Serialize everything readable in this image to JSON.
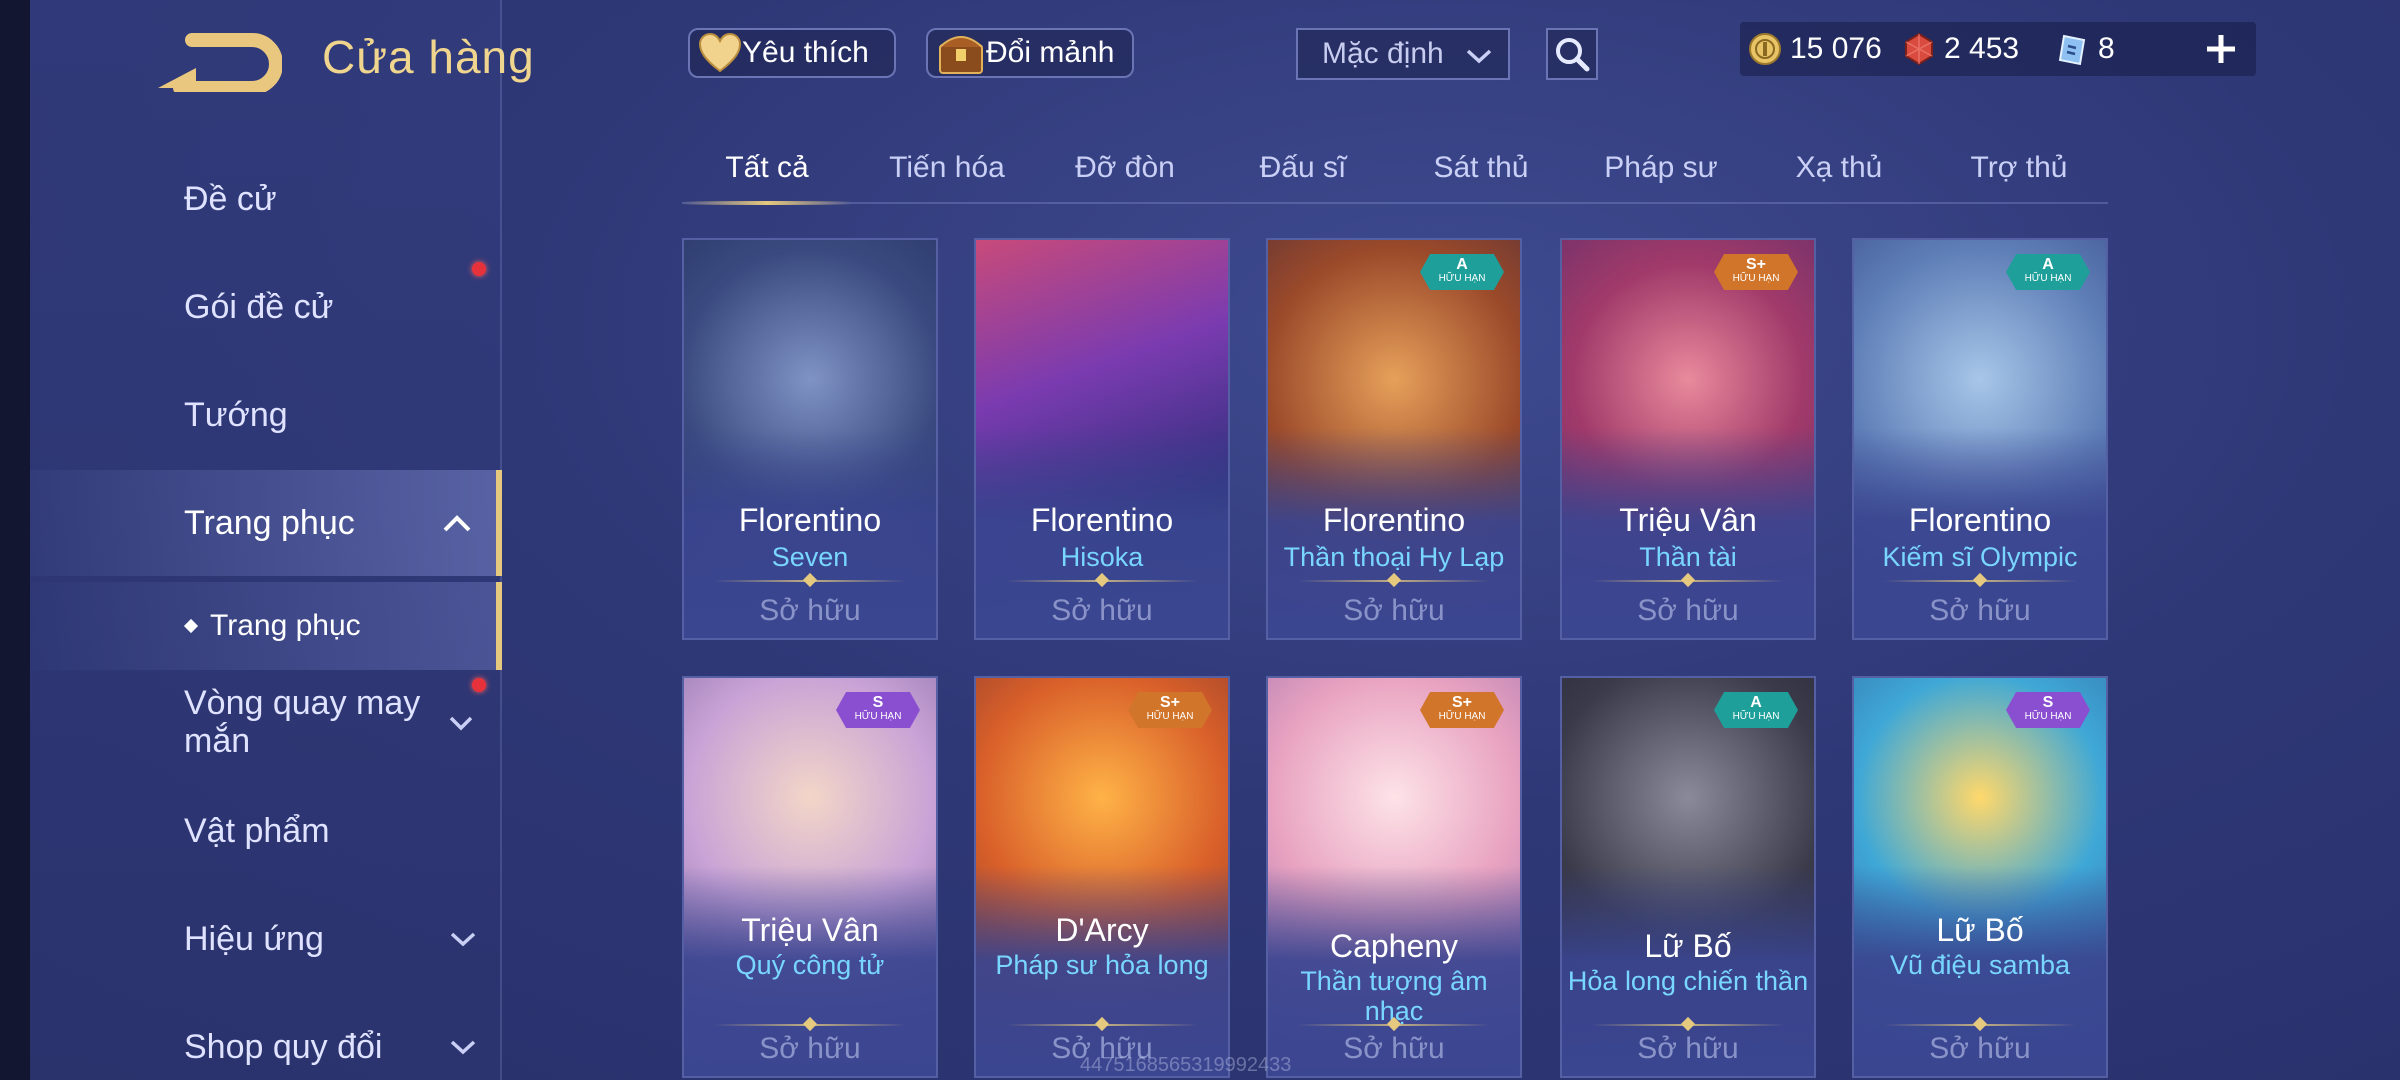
{
  "header": {
    "title": "Cửa hàng",
    "favorites_label": "Yêu thích",
    "exchange_label": "Đổi mảnh",
    "sort_selected": "Mặc định"
  },
  "currency": {
    "gold": "15 076",
    "vouchers": "2 453",
    "tickets": "8"
  },
  "sidebar": {
    "items": [
      {
        "label": "Đề cử"
      },
      {
        "label": "Gói đề cử",
        "red_dot": true
      },
      {
        "label": "Tướng"
      },
      {
        "label": "Trang phục",
        "expanded": true
      },
      {
        "label": "Trang phục",
        "sub": true
      },
      {
        "label": "Vòng quay may mắn",
        "red_dot": true
      },
      {
        "label": "Vật phẩm"
      },
      {
        "label": "Hiệu ứng"
      },
      {
        "label": "Shop quy đổi"
      }
    ]
  },
  "tabs": [
    "Tất cả",
    "Tiến hóa",
    "Đỡ đòn",
    "Đấu sĩ",
    "Sát thủ",
    "Pháp sư",
    "Xạ thủ",
    "Trợ thủ"
  ],
  "active_tab": "Tất cả",
  "cards": [
    {
      "hero": "Florentino",
      "skin": "Seven",
      "status": "Sở hữu",
      "tier": "",
      "tier_sub": ""
    },
    {
      "hero": "Florentino",
      "skin": "Hisoka",
      "status": "Sở hữu",
      "tier": "",
      "tier_sub": ""
    },
    {
      "hero": "Florentino",
      "skin": "Thần thoại Hy Lạp",
      "status": "Sở hữu",
      "tier": "A",
      "tier_sub": "HỮU HẠN"
    },
    {
      "hero": "Triệu Vân",
      "skin": "Thần tài",
      "status": "Sở hữu",
      "tier": "S+",
      "tier_sub": "HỮU HẠN"
    },
    {
      "hero": "Florentino",
      "skin": "Kiếm sĩ Olympic",
      "status": "Sở hữu",
      "tier": "A",
      "tier_sub": "HỮU HẠN"
    },
    {
      "hero": "Triệu Vân",
      "skin": "Quý công tử",
      "status": "Sở hữu",
      "tier": "S",
      "tier_sub": "HỮU HẠN"
    },
    {
      "hero": "D'Arcy",
      "skin": "Pháp sư hỏa long",
      "status": "Sở hữu",
      "tier": "S+",
      "tier_sub": "HỮU HẠN"
    },
    {
      "hero": "Capheny",
      "skin": "Thần tượng âm nhạc",
      "status": "Sở hữu",
      "tier": "S+",
      "tier_sub": "HỮU HẠN"
    },
    {
      "hero": "Lữ Bố",
      "skin": "Hỏa long chiến thần",
      "status": "Sở hữu",
      "tier": "A",
      "tier_sub": "HỮU HẠN"
    },
    {
      "hero": "Lữ Bố",
      "skin": "Vũ điệu samba",
      "status": "Sở hữu",
      "tier": "S",
      "tier_sub": "HỮU HẠN"
    }
  ],
  "watermark": "4475168565319992433",
  "colors": {
    "accent_gold": "#e5c97e",
    "skin_name": "#78d6ff",
    "tier_A": "#1f9f9a",
    "tier_S": "#8a4fd0",
    "tier_Splus": "#d1752a",
    "notification": "#e8323b"
  }
}
